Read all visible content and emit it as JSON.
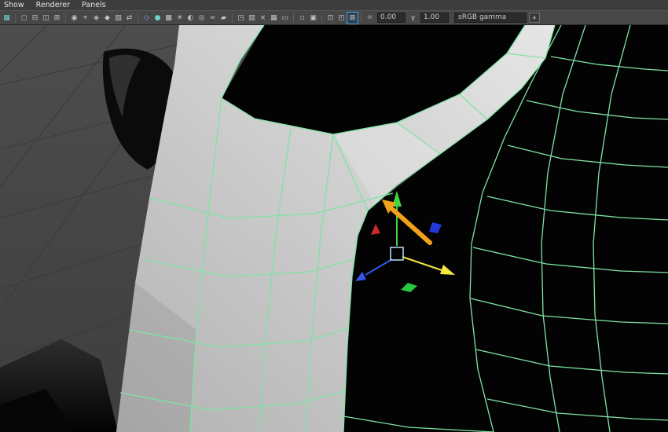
{
  "menu_bar": {
    "items": [
      {
        "label": "Show"
      },
      {
        "label": "Renderer"
      },
      {
        "label": "Panels"
      }
    ]
  },
  "toolbar": {
    "icons": [
      {
        "name": "menu-grid-icon",
        "glyph": "▦"
      },
      {
        "name": "single-pane-icon",
        "glyph": "◻"
      },
      {
        "name": "two-pane-stacked-icon",
        "glyph": "⊟"
      },
      {
        "name": "two-pane-side-icon",
        "glyph": "◫"
      },
      {
        "name": "four-pane-icon",
        "glyph": "⊞"
      },
      {
        "name": "camera-select-icon",
        "glyph": "◉"
      },
      {
        "name": "camera-lock-icon",
        "glyph": "⌖"
      },
      {
        "name": "camera-attributes-icon",
        "glyph": "◈"
      },
      {
        "name": "bookmarks-icon",
        "glyph": "◆"
      },
      {
        "name": "image-plane-icon",
        "glyph": "▨"
      },
      {
        "name": "pan-zoom-icon",
        "glyph": "⇄"
      },
      {
        "name": "wireframe-mode-icon",
        "glyph": "◇"
      },
      {
        "name": "smooth-shade-icon",
        "glyph": "●"
      },
      {
        "name": "textured-mode-icon",
        "glyph": "▩"
      },
      {
        "name": "use-all-lights-icon",
        "glyph": "☀"
      },
      {
        "name": "shadows-icon",
        "glyph": "◐"
      },
      {
        "name": "ambient-occlusion-icon",
        "glyph": "◎"
      },
      {
        "name": "motion-blur-icon",
        "glyph": "≈"
      },
      {
        "name": "anti-aliasing-icon",
        "glyph": "▰"
      },
      {
        "name": "isolate-select-icon",
        "glyph": "◳"
      },
      {
        "name": "xray-icon",
        "glyph": "▥"
      },
      {
        "name": "xray-joints-icon",
        "glyph": "×"
      },
      {
        "name": "grid-toggle-icon",
        "glyph": "▦"
      },
      {
        "name": "film-gate-icon",
        "glyph": "▭"
      },
      {
        "name": "resolution-gate-icon",
        "glyph": "▫"
      },
      {
        "name": "gate-mask-icon",
        "glyph": "▣"
      },
      {
        "name": "field-chart-icon",
        "glyph": "⊡"
      },
      {
        "name": "safe-action-icon",
        "glyph": "◰"
      },
      {
        "name": "safe-title-icon",
        "glyph": "⊠"
      }
    ],
    "exposure": {
      "icon": "☼",
      "value": "0.00"
    },
    "gamma": {
      "icon": "γ",
      "value": "1.00"
    },
    "view_transform": {
      "value": "sRGB gamma",
      "chevron": "▾"
    }
  },
  "viewport": {
    "colors": {
      "background_top": "#4d4d4d",
      "background_bottom": "#3e3e3e",
      "grid_line": "#3a3a3a",
      "wireframe": "#7fe3a4",
      "surface_light": "#e6e6e6",
      "surface_dark": "#b2b2b2"
    },
    "manipulator": {
      "x_color": "#f5e642",
      "y_color": "#3fd63f",
      "z_color": "#3557e8",
      "center_color": "#b8e0f5",
      "plane_x_color": "#cc2a2a",
      "plane_y_color": "#28c840",
      "plane_z_color": "#2438d9"
    },
    "annotation": {
      "arrow_color": "#f2a21a"
    }
  }
}
